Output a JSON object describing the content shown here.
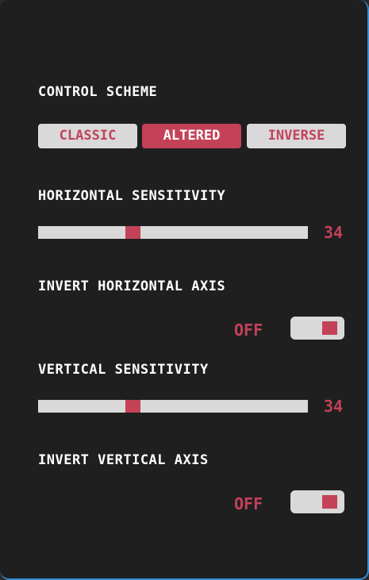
{
  "control_scheme": {
    "label": "CONTROL SCHEME",
    "options": [
      "CLASSIC",
      "ALTERED",
      "INVERSE"
    ],
    "selected": "ALTERED"
  },
  "horizontal_sensitivity": {
    "label": "HORIZONTAL SENSITIVITY",
    "value": "34",
    "fraction": 0.34
  },
  "invert_horizontal": {
    "label": "INVERT HORIZONTAL AXIS",
    "state": "OFF"
  },
  "vertical_sensitivity": {
    "label": "VERTICAL SENSITIVITY",
    "value": "34",
    "fraction": 0.34
  },
  "invert_vertical": {
    "label": "INVERT VERTICAL AXIS",
    "state": "OFF"
  },
  "colors": {
    "accent": "#c44257",
    "control_bg": "#d9d9d9",
    "panel_bg": "#1f1f20",
    "border": "#2f8fd8"
  }
}
